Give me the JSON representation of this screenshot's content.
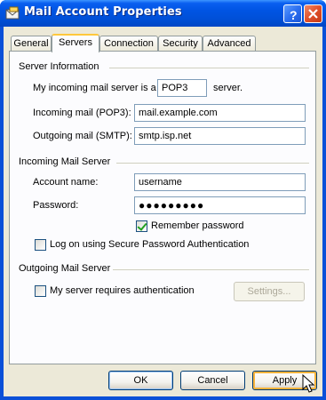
{
  "title": "Mail Account Properties",
  "icons": {
    "title": "mail-envelope-icon",
    "help": "help-icon",
    "close": "close-icon",
    "cursor": "mouse-pointer-icon"
  },
  "tabs": [
    "General",
    "Servers",
    "Connection",
    "Security",
    "Advanced"
  ],
  "active_tab": "Servers",
  "server_info": {
    "heading": "Server Information",
    "incoming_type_prefix": "My incoming mail server is a",
    "incoming_type_value": "POP3",
    "incoming_type_suffix": "server.",
    "incoming_label": "Incoming mail (POP3):",
    "incoming_value": "mail.example.com",
    "outgoing_label": "Outgoing mail (SMTP):",
    "outgoing_value": "smtp.isp.net"
  },
  "incoming_server": {
    "heading": "Incoming Mail Server",
    "account_label": "Account name:",
    "account_value": "username",
    "password_label": "Password:",
    "password_value": "●●●●●●●●●",
    "remember_label": "Remember password",
    "remember_checked": true,
    "spa_label": "Log on using Secure Password Authentication",
    "spa_checked": false
  },
  "outgoing_server": {
    "heading": "Outgoing Mail Server",
    "auth_label": "My server requires authentication",
    "auth_checked": false,
    "settings_label": "Settings..."
  },
  "buttons": {
    "ok": "OK",
    "cancel": "Cancel",
    "apply": "Apply"
  },
  "colors": {
    "titlebar": "#0054e3",
    "client": "#ece9d8",
    "check": "#21a121",
    "hover_border": "#f8b33b"
  }
}
